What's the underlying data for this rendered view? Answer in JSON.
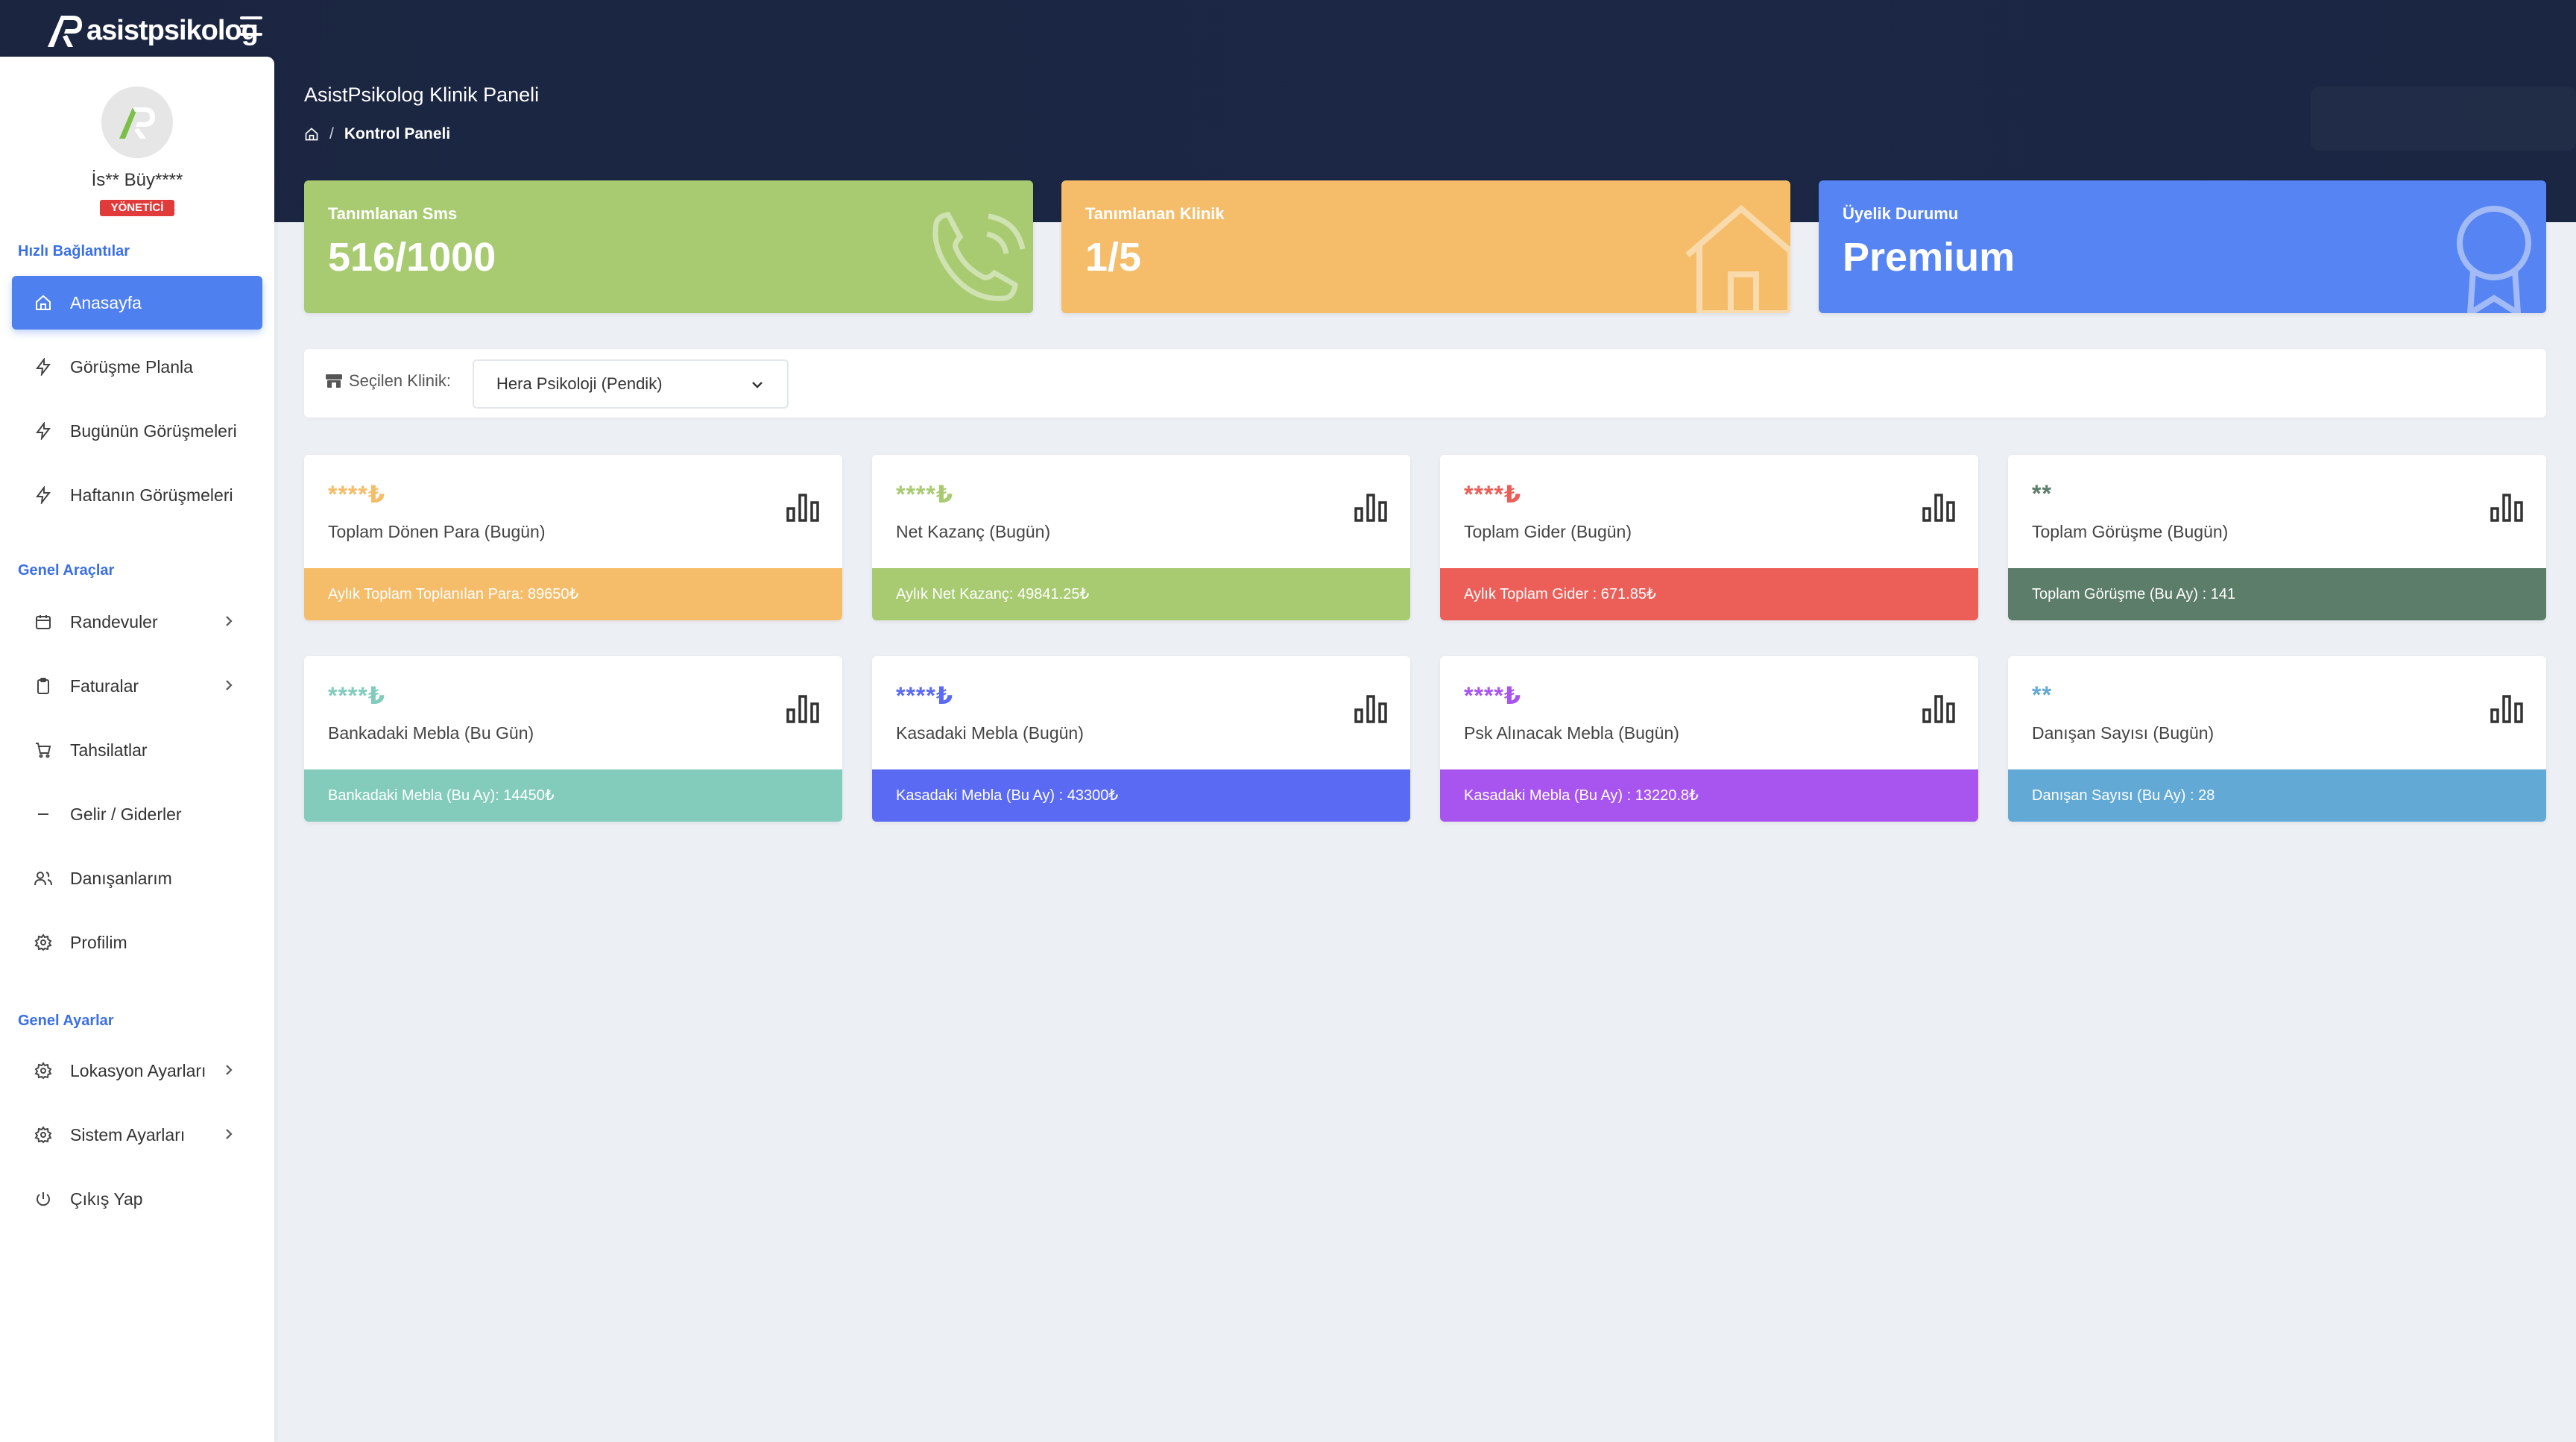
{
  "brand": {
    "name": "asistpsikolog"
  },
  "user": {
    "name": "İs** Büy****",
    "role": "YÖNETİCİ"
  },
  "sidebar": {
    "sections": {
      "quick": "Hızlı Bağlantılar",
      "tools": "Genel Araçlar",
      "settings": "Genel Ayarlar"
    },
    "items": [
      {
        "label": "Anasayfa",
        "icon": "home-icon"
      },
      {
        "label": "Görüşme Planla",
        "icon": "bolt-icon"
      },
      {
        "label": "Bugünün Görüşmeleri",
        "icon": "bolt-icon"
      },
      {
        "label": "Haftanın Görüşmeleri",
        "icon": "bolt-icon"
      },
      {
        "label": "Randevuler",
        "icon": "calendar-icon"
      },
      {
        "label": "Faturalar",
        "icon": "clipboard-icon"
      },
      {
        "label": "Tahsilatlar",
        "icon": "cart-icon"
      },
      {
        "label": "Gelir / Giderler",
        "icon": "minus-icon"
      },
      {
        "label": "Danışanlarım",
        "icon": "users-icon"
      },
      {
        "label": "Profilim",
        "icon": "gear-icon"
      },
      {
        "label": "Lokasyon Ayarları",
        "icon": "gear-icon"
      },
      {
        "label": "Sistem Ayarları",
        "icon": "gear-icon"
      },
      {
        "label": "Çıkış Yap",
        "icon": "power-icon"
      }
    ]
  },
  "header": {
    "title": "AsistPsikolog Klinik Paneli",
    "breadcrumb_sep": "/",
    "breadcrumb_current": "Kontrol Paneli"
  },
  "top_cards": [
    {
      "label": "Tanımlanan Sms",
      "value": "516/1000",
      "color": "#a8cb72",
      "icon": "phone-icon"
    },
    {
      "label": "Tanımlanan Klinik",
      "value": "1/5",
      "color": "#f5bd69",
      "icon": "house-icon"
    },
    {
      "label": "Üyelik Durumu",
      "value": "Premium",
      "color": "#5684f2",
      "icon": "award-icon"
    }
  ],
  "clinic": {
    "label": "Seçilen Klinik:",
    "selected": "Hera Psikoloji (Pendik)"
  },
  "metrics": [
    {
      "stars": "****₺",
      "title": "Toplam Dönen Para (Bugün)",
      "footer": "Aylık Toplam Toplanılan Para: 89650₺",
      "color": "#f5bd69"
    },
    {
      "stars": "****₺",
      "title": "Net Kazanç (Bugün)",
      "footer": "Aylık Net Kazanç: 49841.25₺",
      "color": "#a8cb72"
    },
    {
      "stars": "****₺",
      "title": "Toplam Gider (Bugün)",
      "footer": "Aylık Toplam Gider : 671.85₺",
      "color": "#ec5f58"
    },
    {
      "stars": "**",
      "title": "Toplam Görüşme (Bugün)",
      "footer": "Toplam Görüşme (Bu Ay) : 141",
      "color": "#5c7d69"
    },
    {
      "stars": "****₺",
      "title": "Bankadaki Mebla (Bu Gün)",
      "footer": "Bankadaki Mebla (Bu Ay): 14450₺",
      "color": "#83ccbc"
    },
    {
      "stars": "****₺",
      "title": "Kasadaki Mebla (Bugün)",
      "footer": "Kasadaki Mebla (Bu Ay) : 43300₺",
      "color": "#5a6af3"
    },
    {
      "stars": "****₺",
      "title": "Psk Alınacak Mebla (Bugün)",
      "footer": "Kasadaki Mebla (Bu Ay) : 13220.8₺",
      "color": "#a855f0"
    },
    {
      "stars": "**",
      "title": "Danışan Sayısı (Bugün)",
      "footer": "Danışan Sayısı (Bu Ay) : 28",
      "color": "#62a9d6"
    }
  ]
}
